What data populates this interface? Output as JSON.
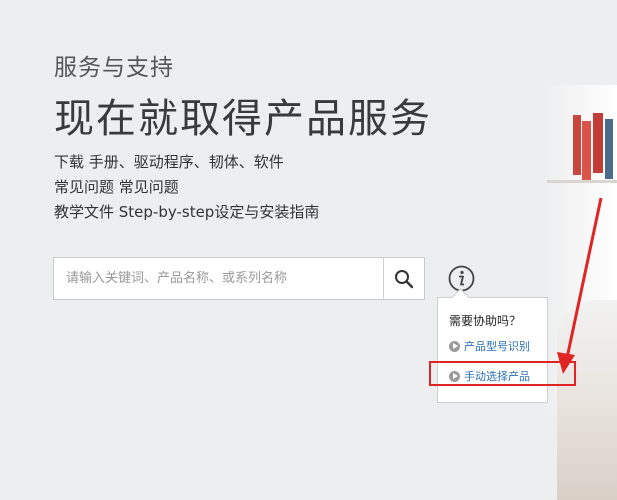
{
  "header": {
    "subtitle": "服务与支持",
    "title": "现在就取得产品服务"
  },
  "features": [
    "下载 手册、驱动程序、韧体、软件",
    "常见问题 常见问题",
    "教学文件 Step-by-step设定与安装指南"
  ],
  "search": {
    "placeholder": "请输入关键词、产品名称、或系列名称",
    "value": "",
    "icon": "search-icon"
  },
  "info": {
    "icon": "info-icon"
  },
  "help": {
    "title": "需要协助吗？",
    "links": [
      "产品型号识别",
      "手动选择产品"
    ]
  },
  "colors": {
    "accent_link": "#2a6fb3",
    "annotation": "#e02424",
    "background": "#eceeef"
  }
}
